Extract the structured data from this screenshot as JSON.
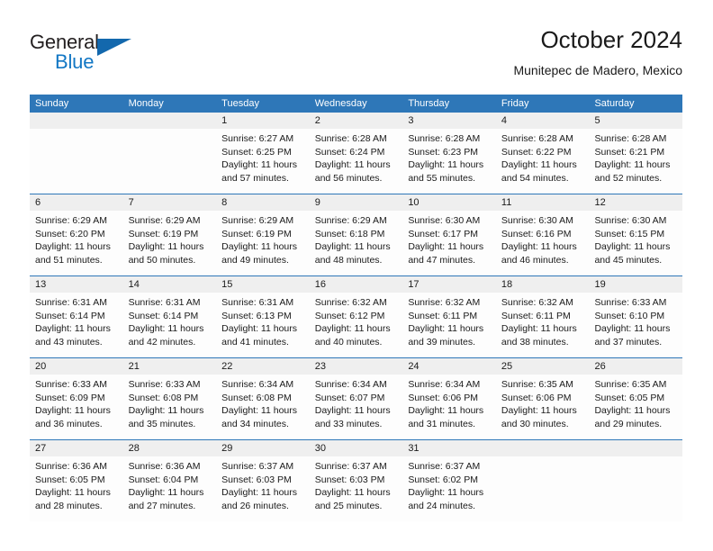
{
  "brand": {
    "name_part1": "General",
    "name_part2": "Blue",
    "triangle_color": "#1368ad",
    "blue_color": "#1277c4"
  },
  "header": {
    "title": "October 2024",
    "subtitle": "Munitepec de Madero, Mexico"
  },
  "theme": {
    "header_bg": "#2e77b8",
    "header_text": "#ffffff",
    "date_band_bg": "#efefef",
    "cell_bg": "#fdfdfd",
    "row_separator": "#2e77b8"
  },
  "weekdays": [
    "Sunday",
    "Monday",
    "Tuesday",
    "Wednesday",
    "Thursday",
    "Friday",
    "Saturday"
  ],
  "weeks": [
    [
      {
        "day": "",
        "sunrise": "",
        "sunset": "",
        "daylight": "",
        "daylight2": ""
      },
      {
        "day": "",
        "sunrise": "",
        "sunset": "",
        "daylight": "",
        "daylight2": ""
      },
      {
        "day": "1",
        "sunrise": "Sunrise: 6:27 AM",
        "sunset": "Sunset: 6:25 PM",
        "daylight": "Daylight: 11 hours",
        "daylight2": "and 57 minutes."
      },
      {
        "day": "2",
        "sunrise": "Sunrise: 6:28 AM",
        "sunset": "Sunset: 6:24 PM",
        "daylight": "Daylight: 11 hours",
        "daylight2": "and 56 minutes."
      },
      {
        "day": "3",
        "sunrise": "Sunrise: 6:28 AM",
        "sunset": "Sunset: 6:23 PM",
        "daylight": "Daylight: 11 hours",
        "daylight2": "and 55 minutes."
      },
      {
        "day": "4",
        "sunrise": "Sunrise: 6:28 AM",
        "sunset": "Sunset: 6:22 PM",
        "daylight": "Daylight: 11 hours",
        "daylight2": "and 54 minutes."
      },
      {
        "day": "5",
        "sunrise": "Sunrise: 6:28 AM",
        "sunset": "Sunset: 6:21 PM",
        "daylight": "Daylight: 11 hours",
        "daylight2": "and 52 minutes."
      }
    ],
    [
      {
        "day": "6",
        "sunrise": "Sunrise: 6:29 AM",
        "sunset": "Sunset: 6:20 PM",
        "daylight": "Daylight: 11 hours",
        "daylight2": "and 51 minutes."
      },
      {
        "day": "7",
        "sunrise": "Sunrise: 6:29 AM",
        "sunset": "Sunset: 6:19 PM",
        "daylight": "Daylight: 11 hours",
        "daylight2": "and 50 minutes."
      },
      {
        "day": "8",
        "sunrise": "Sunrise: 6:29 AM",
        "sunset": "Sunset: 6:19 PM",
        "daylight": "Daylight: 11 hours",
        "daylight2": "and 49 minutes."
      },
      {
        "day": "9",
        "sunrise": "Sunrise: 6:29 AM",
        "sunset": "Sunset: 6:18 PM",
        "daylight": "Daylight: 11 hours",
        "daylight2": "and 48 minutes."
      },
      {
        "day": "10",
        "sunrise": "Sunrise: 6:30 AM",
        "sunset": "Sunset: 6:17 PM",
        "daylight": "Daylight: 11 hours",
        "daylight2": "and 47 minutes."
      },
      {
        "day": "11",
        "sunrise": "Sunrise: 6:30 AM",
        "sunset": "Sunset: 6:16 PM",
        "daylight": "Daylight: 11 hours",
        "daylight2": "and 46 minutes."
      },
      {
        "day": "12",
        "sunrise": "Sunrise: 6:30 AM",
        "sunset": "Sunset: 6:15 PM",
        "daylight": "Daylight: 11 hours",
        "daylight2": "and 45 minutes."
      }
    ],
    [
      {
        "day": "13",
        "sunrise": "Sunrise: 6:31 AM",
        "sunset": "Sunset: 6:14 PM",
        "daylight": "Daylight: 11 hours",
        "daylight2": "and 43 minutes."
      },
      {
        "day": "14",
        "sunrise": "Sunrise: 6:31 AM",
        "sunset": "Sunset: 6:14 PM",
        "daylight": "Daylight: 11 hours",
        "daylight2": "and 42 minutes."
      },
      {
        "day": "15",
        "sunrise": "Sunrise: 6:31 AM",
        "sunset": "Sunset: 6:13 PM",
        "daylight": "Daylight: 11 hours",
        "daylight2": "and 41 minutes."
      },
      {
        "day": "16",
        "sunrise": "Sunrise: 6:32 AM",
        "sunset": "Sunset: 6:12 PM",
        "daylight": "Daylight: 11 hours",
        "daylight2": "and 40 minutes."
      },
      {
        "day": "17",
        "sunrise": "Sunrise: 6:32 AM",
        "sunset": "Sunset: 6:11 PM",
        "daylight": "Daylight: 11 hours",
        "daylight2": "and 39 minutes."
      },
      {
        "day": "18",
        "sunrise": "Sunrise: 6:32 AM",
        "sunset": "Sunset: 6:11 PM",
        "daylight": "Daylight: 11 hours",
        "daylight2": "and 38 minutes."
      },
      {
        "day": "19",
        "sunrise": "Sunrise: 6:33 AM",
        "sunset": "Sunset: 6:10 PM",
        "daylight": "Daylight: 11 hours",
        "daylight2": "and 37 minutes."
      }
    ],
    [
      {
        "day": "20",
        "sunrise": "Sunrise: 6:33 AM",
        "sunset": "Sunset: 6:09 PM",
        "daylight": "Daylight: 11 hours",
        "daylight2": "and 36 minutes."
      },
      {
        "day": "21",
        "sunrise": "Sunrise: 6:33 AM",
        "sunset": "Sunset: 6:08 PM",
        "daylight": "Daylight: 11 hours",
        "daylight2": "and 35 minutes."
      },
      {
        "day": "22",
        "sunrise": "Sunrise: 6:34 AM",
        "sunset": "Sunset: 6:08 PM",
        "daylight": "Daylight: 11 hours",
        "daylight2": "and 34 minutes."
      },
      {
        "day": "23",
        "sunrise": "Sunrise: 6:34 AM",
        "sunset": "Sunset: 6:07 PM",
        "daylight": "Daylight: 11 hours",
        "daylight2": "and 33 minutes."
      },
      {
        "day": "24",
        "sunrise": "Sunrise: 6:34 AM",
        "sunset": "Sunset: 6:06 PM",
        "daylight": "Daylight: 11 hours",
        "daylight2": "and 31 minutes."
      },
      {
        "day": "25",
        "sunrise": "Sunrise: 6:35 AM",
        "sunset": "Sunset: 6:06 PM",
        "daylight": "Daylight: 11 hours",
        "daylight2": "and 30 minutes."
      },
      {
        "day": "26",
        "sunrise": "Sunrise: 6:35 AM",
        "sunset": "Sunset: 6:05 PM",
        "daylight": "Daylight: 11 hours",
        "daylight2": "and 29 minutes."
      }
    ],
    [
      {
        "day": "27",
        "sunrise": "Sunrise: 6:36 AM",
        "sunset": "Sunset: 6:05 PM",
        "daylight": "Daylight: 11 hours",
        "daylight2": "and 28 minutes."
      },
      {
        "day": "28",
        "sunrise": "Sunrise: 6:36 AM",
        "sunset": "Sunset: 6:04 PM",
        "daylight": "Daylight: 11 hours",
        "daylight2": "and 27 minutes."
      },
      {
        "day": "29",
        "sunrise": "Sunrise: 6:37 AM",
        "sunset": "Sunset: 6:03 PM",
        "daylight": "Daylight: 11 hours",
        "daylight2": "and 26 minutes."
      },
      {
        "day": "30",
        "sunrise": "Sunrise: 6:37 AM",
        "sunset": "Sunset: 6:03 PM",
        "daylight": "Daylight: 11 hours",
        "daylight2": "and 25 minutes."
      },
      {
        "day": "31",
        "sunrise": "Sunrise: 6:37 AM",
        "sunset": "Sunset: 6:02 PM",
        "daylight": "Daylight: 11 hours",
        "daylight2": "and 24 minutes."
      },
      {
        "day": "",
        "sunrise": "",
        "sunset": "",
        "daylight": "",
        "daylight2": ""
      },
      {
        "day": "",
        "sunrise": "",
        "sunset": "",
        "daylight": "",
        "daylight2": ""
      }
    ]
  ]
}
